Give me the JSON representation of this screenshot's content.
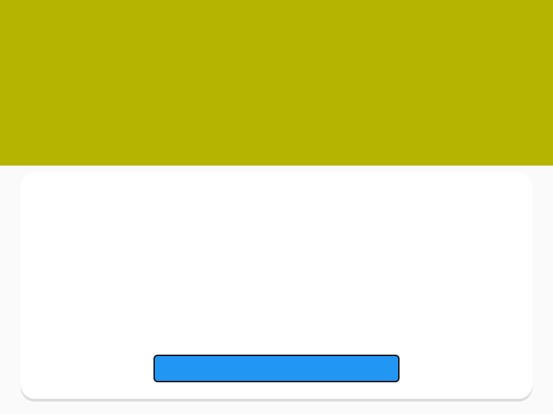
{
  "hero": {
    "color": "#b5b400"
  },
  "card": {
    "title": "",
    "lead": "",
    "detail": "",
    "button_label": ""
  },
  "theme": {
    "button_color": "#2196f3",
    "text_color": "#222222"
  }
}
